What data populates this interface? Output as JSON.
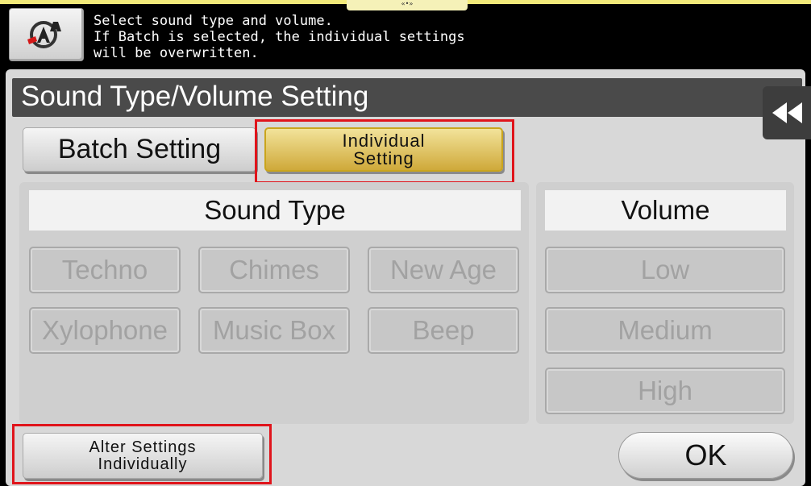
{
  "header": {
    "tab_glyph": "«•»",
    "help_icon": "sound-help-icon",
    "message": "Select sound type and volume.\nIf Batch is selected, the individual settings\nwill be overwritten."
  },
  "screen": {
    "title": "Sound Type/Volume Setting",
    "collapse_icon": "double-chevron-left-icon"
  },
  "setting_mode": {
    "batch_label": "Batch Setting",
    "individual_label_line1": "Individual",
    "individual_label_line2": "Setting",
    "selected": "Individual Setting"
  },
  "sound_type": {
    "heading": "Sound Type",
    "options": [
      "Techno",
      "Chimes",
      "New Age",
      "Xylophone",
      "Music Box",
      "Beep"
    ],
    "enabled": false
  },
  "volume": {
    "heading": "Volume",
    "options": [
      "Low",
      "Medium",
      "High"
    ],
    "enabled": false
  },
  "footer": {
    "alter_line1": "Alter Settings",
    "alter_line2": "Individually",
    "ok_label": "OK"
  },
  "colors": {
    "selected_accent": "#e0c45a",
    "highlight_box": "#e0141b"
  }
}
